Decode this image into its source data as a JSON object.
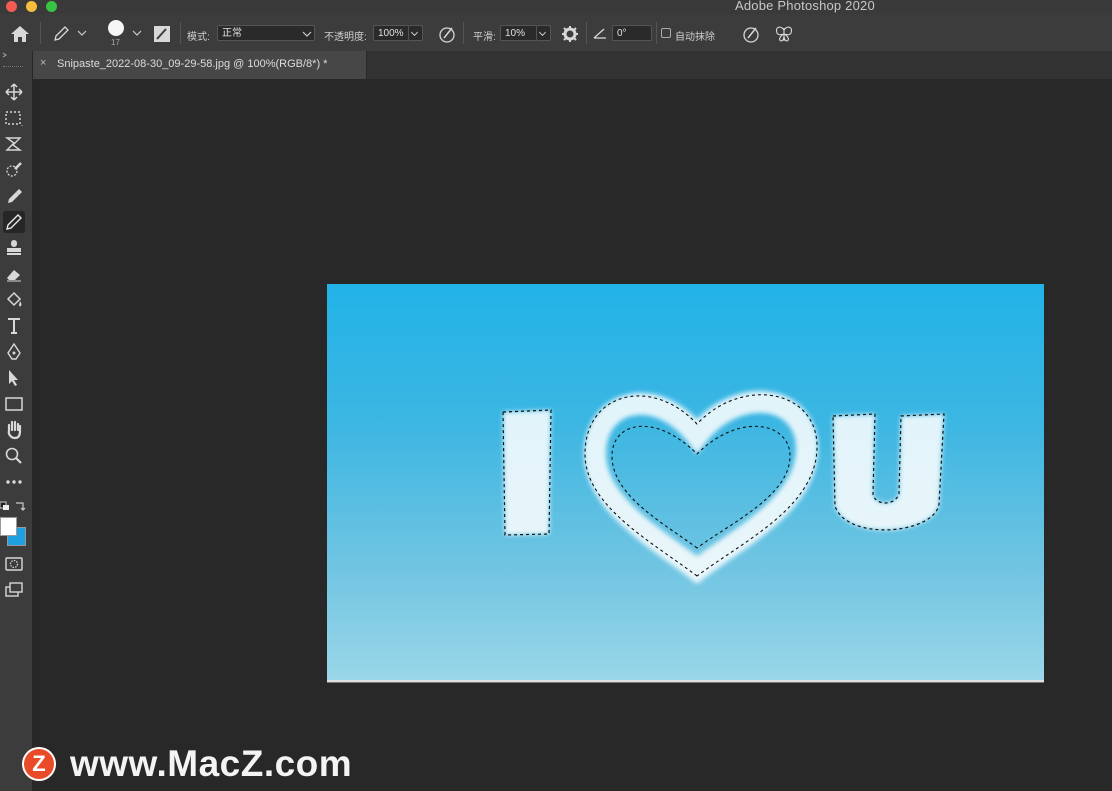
{
  "app": {
    "title": "Adobe Photoshop 2020"
  },
  "options": {
    "brush_size": "17",
    "mode_label": "模式:",
    "mode_value": "正常",
    "opacity_label": "不透明度:",
    "opacity_value": "100%",
    "smoothing_label": "平滑:",
    "smoothing_value": "10%",
    "angle_value": "0°",
    "auto_erase_label": "自动抹除"
  },
  "document": {
    "tab_close": "×",
    "tab_label": "Snipaste_2022-08-30_09-29-58.jpg @ 100%(RGB/8*) *"
  },
  "artwork": {
    "letters": [
      "I",
      "U"
    ]
  },
  "watermark": {
    "logo": "Z",
    "text": "www.MacZ.com"
  },
  "tools": [
    "move-tool-icon",
    "marquee-tool-icon",
    "lasso-tool-icon",
    "quick-select-tool-icon",
    "eyedropper-tool-icon",
    "pencil-tool-icon",
    "stamp-tool-icon",
    "eraser-tool-icon",
    "paint-bucket-tool-icon",
    "type-tool-icon",
    "pen-tool-icon",
    "path-select-tool-icon",
    "rectangle-tool-icon",
    "hand-tool-icon",
    "zoom-tool-icon",
    "more-tools-icon"
  ],
  "colors": {
    "foreground": "#ffffff",
    "background": "#1fa0e0"
  }
}
